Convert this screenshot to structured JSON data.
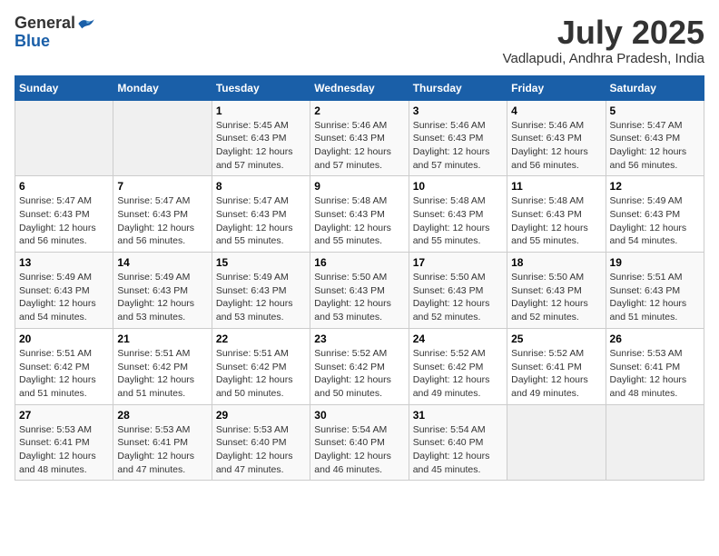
{
  "logo": {
    "general": "General",
    "blue": "Blue"
  },
  "title": "July 2025",
  "location": "Vadlapudi, Andhra Pradesh, India",
  "days_of_week": [
    "Sunday",
    "Monday",
    "Tuesday",
    "Wednesday",
    "Thursday",
    "Friday",
    "Saturday"
  ],
  "weeks": [
    [
      {
        "day": "",
        "sunrise": "",
        "sunset": "",
        "daylight": ""
      },
      {
        "day": "",
        "sunrise": "",
        "sunset": "",
        "daylight": ""
      },
      {
        "day": "1",
        "sunrise": "Sunrise: 5:45 AM",
        "sunset": "Sunset: 6:43 PM",
        "daylight": "Daylight: 12 hours and 57 minutes."
      },
      {
        "day": "2",
        "sunrise": "Sunrise: 5:46 AM",
        "sunset": "Sunset: 6:43 PM",
        "daylight": "Daylight: 12 hours and 57 minutes."
      },
      {
        "day": "3",
        "sunrise": "Sunrise: 5:46 AM",
        "sunset": "Sunset: 6:43 PM",
        "daylight": "Daylight: 12 hours and 57 minutes."
      },
      {
        "day": "4",
        "sunrise": "Sunrise: 5:46 AM",
        "sunset": "Sunset: 6:43 PM",
        "daylight": "Daylight: 12 hours and 56 minutes."
      },
      {
        "day": "5",
        "sunrise": "Sunrise: 5:47 AM",
        "sunset": "Sunset: 6:43 PM",
        "daylight": "Daylight: 12 hours and 56 minutes."
      }
    ],
    [
      {
        "day": "6",
        "sunrise": "Sunrise: 5:47 AM",
        "sunset": "Sunset: 6:43 PM",
        "daylight": "Daylight: 12 hours and 56 minutes."
      },
      {
        "day": "7",
        "sunrise": "Sunrise: 5:47 AM",
        "sunset": "Sunset: 6:43 PM",
        "daylight": "Daylight: 12 hours and 56 minutes."
      },
      {
        "day": "8",
        "sunrise": "Sunrise: 5:47 AM",
        "sunset": "Sunset: 6:43 PM",
        "daylight": "Daylight: 12 hours and 55 minutes."
      },
      {
        "day": "9",
        "sunrise": "Sunrise: 5:48 AM",
        "sunset": "Sunset: 6:43 PM",
        "daylight": "Daylight: 12 hours and 55 minutes."
      },
      {
        "day": "10",
        "sunrise": "Sunrise: 5:48 AM",
        "sunset": "Sunset: 6:43 PM",
        "daylight": "Daylight: 12 hours and 55 minutes."
      },
      {
        "day": "11",
        "sunrise": "Sunrise: 5:48 AM",
        "sunset": "Sunset: 6:43 PM",
        "daylight": "Daylight: 12 hours and 55 minutes."
      },
      {
        "day": "12",
        "sunrise": "Sunrise: 5:49 AM",
        "sunset": "Sunset: 6:43 PM",
        "daylight": "Daylight: 12 hours and 54 minutes."
      }
    ],
    [
      {
        "day": "13",
        "sunrise": "Sunrise: 5:49 AM",
        "sunset": "Sunset: 6:43 PM",
        "daylight": "Daylight: 12 hours and 54 minutes."
      },
      {
        "day": "14",
        "sunrise": "Sunrise: 5:49 AM",
        "sunset": "Sunset: 6:43 PM",
        "daylight": "Daylight: 12 hours and 53 minutes."
      },
      {
        "day": "15",
        "sunrise": "Sunrise: 5:49 AM",
        "sunset": "Sunset: 6:43 PM",
        "daylight": "Daylight: 12 hours and 53 minutes."
      },
      {
        "day": "16",
        "sunrise": "Sunrise: 5:50 AM",
        "sunset": "Sunset: 6:43 PM",
        "daylight": "Daylight: 12 hours and 53 minutes."
      },
      {
        "day": "17",
        "sunrise": "Sunrise: 5:50 AM",
        "sunset": "Sunset: 6:43 PM",
        "daylight": "Daylight: 12 hours and 52 minutes."
      },
      {
        "day": "18",
        "sunrise": "Sunrise: 5:50 AM",
        "sunset": "Sunset: 6:43 PM",
        "daylight": "Daylight: 12 hours and 52 minutes."
      },
      {
        "day": "19",
        "sunrise": "Sunrise: 5:51 AM",
        "sunset": "Sunset: 6:43 PM",
        "daylight": "Daylight: 12 hours and 51 minutes."
      }
    ],
    [
      {
        "day": "20",
        "sunrise": "Sunrise: 5:51 AM",
        "sunset": "Sunset: 6:42 PM",
        "daylight": "Daylight: 12 hours and 51 minutes."
      },
      {
        "day": "21",
        "sunrise": "Sunrise: 5:51 AM",
        "sunset": "Sunset: 6:42 PM",
        "daylight": "Daylight: 12 hours and 51 minutes."
      },
      {
        "day": "22",
        "sunrise": "Sunrise: 5:51 AM",
        "sunset": "Sunset: 6:42 PM",
        "daylight": "Daylight: 12 hours and 50 minutes."
      },
      {
        "day": "23",
        "sunrise": "Sunrise: 5:52 AM",
        "sunset": "Sunset: 6:42 PM",
        "daylight": "Daylight: 12 hours and 50 minutes."
      },
      {
        "day": "24",
        "sunrise": "Sunrise: 5:52 AM",
        "sunset": "Sunset: 6:42 PM",
        "daylight": "Daylight: 12 hours and 49 minutes."
      },
      {
        "day": "25",
        "sunrise": "Sunrise: 5:52 AM",
        "sunset": "Sunset: 6:41 PM",
        "daylight": "Daylight: 12 hours and 49 minutes."
      },
      {
        "day": "26",
        "sunrise": "Sunrise: 5:53 AM",
        "sunset": "Sunset: 6:41 PM",
        "daylight": "Daylight: 12 hours and 48 minutes."
      }
    ],
    [
      {
        "day": "27",
        "sunrise": "Sunrise: 5:53 AM",
        "sunset": "Sunset: 6:41 PM",
        "daylight": "Daylight: 12 hours and 48 minutes."
      },
      {
        "day": "28",
        "sunrise": "Sunrise: 5:53 AM",
        "sunset": "Sunset: 6:41 PM",
        "daylight": "Daylight: 12 hours and 47 minutes."
      },
      {
        "day": "29",
        "sunrise": "Sunrise: 5:53 AM",
        "sunset": "Sunset: 6:40 PM",
        "daylight": "Daylight: 12 hours and 47 minutes."
      },
      {
        "day": "30",
        "sunrise": "Sunrise: 5:54 AM",
        "sunset": "Sunset: 6:40 PM",
        "daylight": "Daylight: 12 hours and 46 minutes."
      },
      {
        "day": "31",
        "sunrise": "Sunrise: 5:54 AM",
        "sunset": "Sunset: 6:40 PM",
        "daylight": "Daylight: 12 hours and 45 minutes."
      },
      {
        "day": "",
        "sunrise": "",
        "sunset": "",
        "daylight": ""
      },
      {
        "day": "",
        "sunrise": "",
        "sunset": "",
        "daylight": ""
      }
    ]
  ]
}
